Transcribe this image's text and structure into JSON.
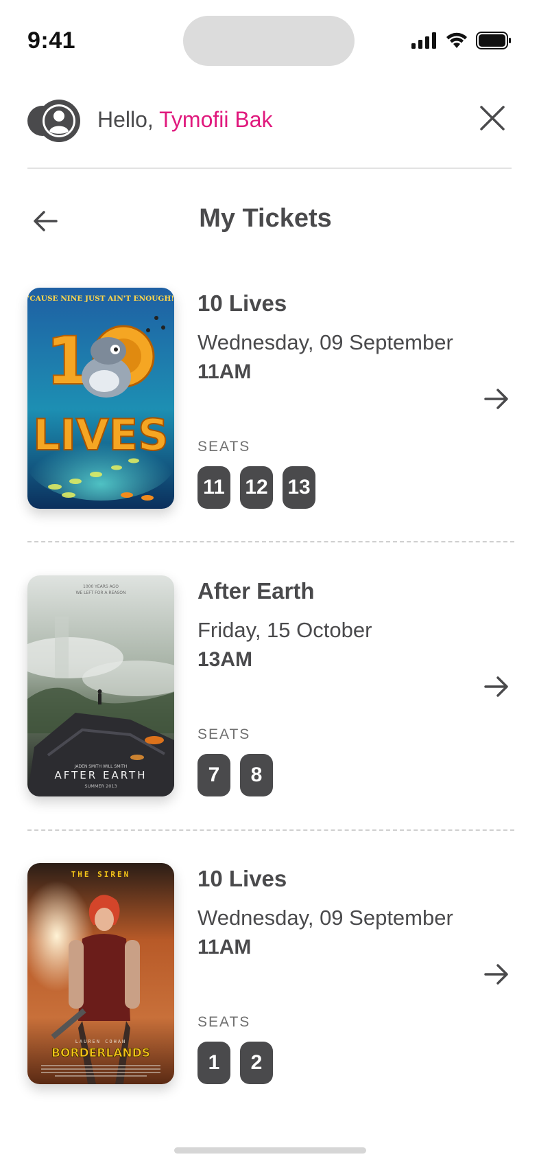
{
  "status_bar": {
    "time": "9:41"
  },
  "header": {
    "greeting": "Hello,",
    "user_name": "Tymofii Bak"
  },
  "page": {
    "title": "My Tickets"
  },
  "colors": {
    "accent": "#e0197d",
    "text": "#4a4a4c",
    "seat_bg": "#4a4a4c"
  },
  "icons": {
    "avatar": "user-circle-icon",
    "close": "close-icon",
    "back": "arrow-left-icon",
    "open": "arrow-right-icon"
  },
  "tickets": [
    {
      "title": "10 Lives",
      "date": "Wednesday, 09 September",
      "time": "11AM",
      "seats_label": "SEATS",
      "seats": [
        "11",
        "12",
        "13"
      ],
      "poster": {
        "tagline": "'CAUSE NINE JUST AIN'T ENOUGH!",
        "logo_top": "10",
        "logo_bottom": "LIVES"
      }
    },
    {
      "title": "After Earth",
      "date": "Friday, 15 October",
      "time": "13AM",
      "seats_label": "SEATS",
      "seats": [
        "7",
        "8"
      ],
      "poster": {
        "tagline": "1000 YEARS AGO",
        "tagline2": "WE LEFT FOR A REASON",
        "credits": "JADEN SMITH   WILL SMITH",
        "logo": "AFTER EARTH",
        "footer": "SUMMER 2013"
      }
    },
    {
      "title": "10 Lives",
      "date": "Wednesday, 09 September",
      "time": "11AM",
      "seats_label": "SEATS",
      "seats": [
        "1",
        "2"
      ],
      "poster": {
        "tagline": "THE SIREN",
        "credits": "LAUREN COHAN",
        "logo": "BORDERLANDS"
      }
    }
  ]
}
